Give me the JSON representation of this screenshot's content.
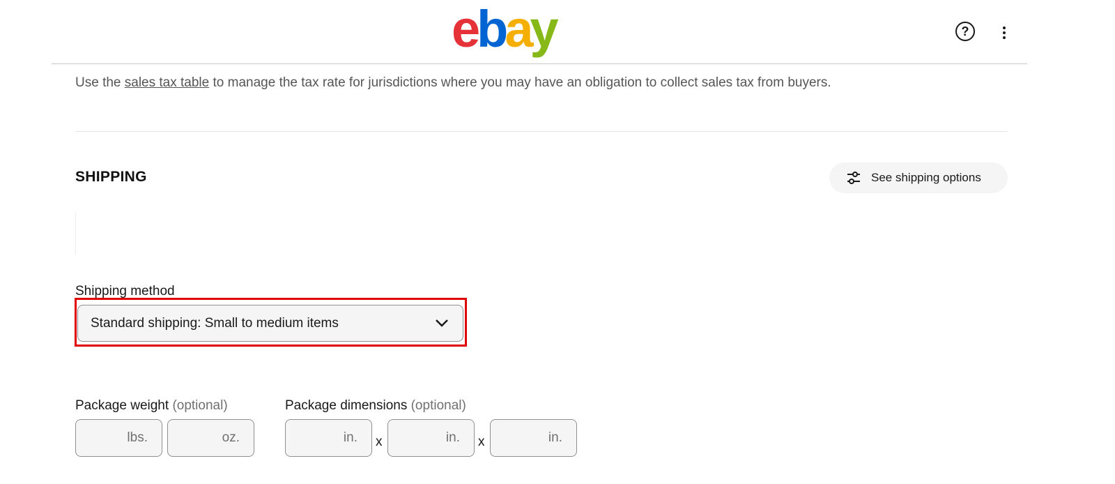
{
  "header": {
    "logo": [
      "e",
      "b",
      "a",
      "y"
    ],
    "help_icon": "?",
    "help_icon_name": "help-circle-icon",
    "more_icon_name": "vertical-ellipsis-icon"
  },
  "tax_notice": {
    "prefix": "Use the ",
    "link_text": "sales tax table",
    "suffix": " to manage the tax rate for jurisdictions where you may have an obligation to collect sales tax from buyers."
  },
  "shipping": {
    "title": "SHIPPING",
    "see_options_label": "See shipping options",
    "see_options_icon": "sliders-icon",
    "method_label": "Shipping method",
    "method_value": "Standard shipping: Small to medium items",
    "weight_label": "Package weight",
    "dimensions_label": "Package dimensions",
    "optional_text": "(optional)",
    "weight_units": [
      "lbs.",
      "oz."
    ],
    "dimension_units": [
      "in.",
      "in.",
      "in."
    ],
    "times_symbol": "x"
  },
  "colors": {
    "highlight": "#e00000",
    "logo_e": "#e53238",
    "logo_b": "#0064d2",
    "logo_a": "#f5af02",
    "logo_y": "#86b817"
  }
}
